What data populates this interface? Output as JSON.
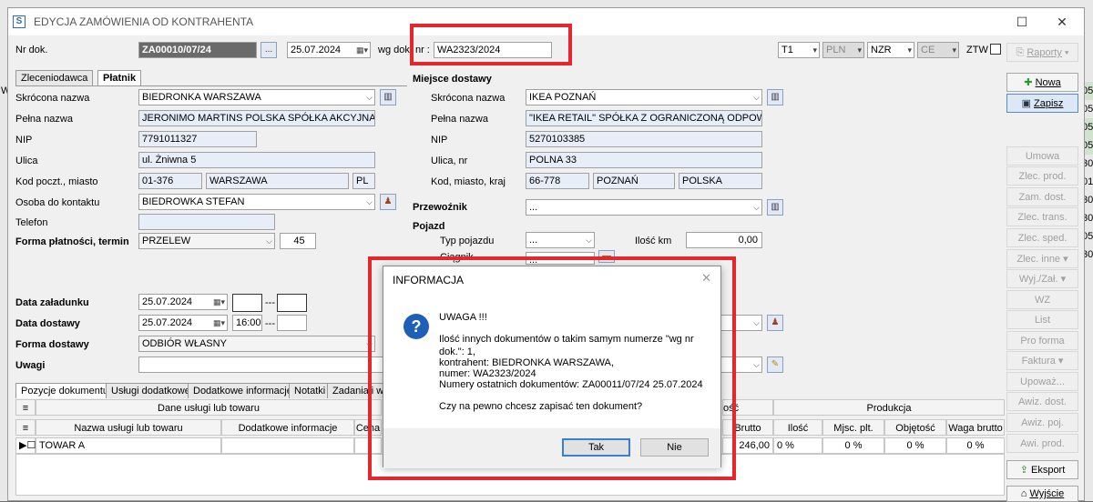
{
  "window": {
    "title": "EDYCJA ZAMÓWIENIA OD KONTRAHENTA",
    "minimize": "☐",
    "close": "✕"
  },
  "header": {
    "nr_dok_label": "Nr dok.",
    "nr_dok_value": "ZA00010/07/24",
    "ellipsis": "...",
    "date_value": "25.07.2024",
    "wg_dok_label": "wg dok. nr :",
    "wg_dok_value": "WA2323/2024",
    "t1": "T1",
    "currency": "PLN",
    "nzr": "NZR",
    "ce": "CE",
    "ztw_label": "ZTW",
    "raporty": "Raporty"
  },
  "client_tabs": [
    "Zleceniodawca",
    "Płatnik"
  ],
  "client": {
    "skrocona_label": "Skrócona nazwa",
    "skrocona_value": "BIEDRONKA WARSZAWA",
    "pelna_label": "Pełna nazwa",
    "pelna_value": "JERONIMO MARTINS POLSKA SPÓŁKA AKCYJNA",
    "nip_label": "NIP",
    "nip_value": "7791011327",
    "ulica_label": "Ulica",
    "ulica_value": "ul. Żniwna 5",
    "kod_label": "Kod poczt., miasto",
    "kod_value": "01-376",
    "miasto_value": "WARSZAWA",
    "kraj_value": "PL",
    "osoba_label": "Osoba do kontaktu",
    "osoba_value": "BIEDROWKA STEFAN",
    "telefon_label": "Telefon",
    "forma_platnosci_label": "Forma płatności, termin",
    "forma_platnosci_value": "PRZELEW",
    "termin_value": "45"
  },
  "delivery": {
    "section_label": "Miejsce dostawy",
    "skrocona_label": "Skrócona nazwa",
    "skrocona_value": "IKEA POZNAŃ",
    "pelna_label": "Pełna nazwa",
    "pelna_value": "\"IKEA RETAIL\" SPÓŁKA Z OGRANICZONĄ ODPOWIEDZI.",
    "nip_label": "NIP",
    "nip_value": "5270103385",
    "ulica_label": "Ulica, nr",
    "ulica_value": "POLNA 33",
    "kod_label": "Kod, miasto, kraj",
    "kod_value": "66-778",
    "miasto_value": "POZNAŃ",
    "kraj_value": "POLSKA",
    "przewoznik_label": "Przewoźnik",
    "przewoznik_value": "...",
    "pojazd_label": "Pojazd",
    "typ_label": "Typ pojazdu",
    "typ_value": "...",
    "ilosc_km_label": "Ilość km",
    "ilosc_km_value": "0,00",
    "ciagnik_label": "Ciągnik",
    "ciagnik_value": "..."
  },
  "dates": {
    "zaladunek_label": "Data załadunku",
    "zaladunek_value": "25.07.2024",
    "dostawa_label": "Data dostawy",
    "dostawa_value": "25.07.2024",
    "dostawa_time": "16:00",
    "forma_dostawy_label": "Forma dostawy",
    "forma_dostawy_value": "ODBIÓR WŁASNY",
    "uwagi_label": "Uwagi",
    "sep": "---"
  },
  "doc_tabs": [
    "Pozycje dokumentu",
    "Usługi dodatkowe",
    "Dodatkowe informacje",
    "Notatki",
    "Zadania i wa"
  ],
  "grid": {
    "group1": "Dane usługi lub towaru",
    "group_produkcja": "Produkcja",
    "col_name": "Nazwa usługi lub towaru",
    "col_info": "Dodatkowe informacje",
    "col_cena": "Cena",
    "col_brutto": "Brutto",
    "col_ilosc": "Ilość",
    "col_miejsc": "Mjsc. plt.",
    "col_objetosc": "Objętość",
    "col_waga": "Waga brutto",
    "col_o": "ość",
    "row_name": "TOWAR A",
    "row_brutto": "246,00",
    "row_ilosc": "0 %",
    "row_miejsc": "0 %",
    "row_objetosc": "0 %",
    "row_waga": "0 %"
  },
  "side_buttons": {
    "nowa": "Nowa",
    "zapisz": "Zapisz",
    "umowa": "Umowa",
    "zlec_prod": "Zlec. prod.",
    "zam_dost": "Zam. dost.",
    "zlec_trans": "Zlec. trans.",
    "zlec_sped": "Zlec. sped.",
    "zlec_inne": "Zlec. inne",
    "wyj_zal": "Wyj./Zał.",
    "wz": "WZ",
    "list": "List",
    "pro_forma": "Pro forma",
    "faktura": "Faktura",
    "upowaz": "Upoważ...",
    "awiz_dost": "Awiz. dost.",
    "awiz_poj": "Awiz. poj.",
    "awi_prod": "Awi. prod.",
    "eksport": "Eksport",
    "wyjscie": "Wyjście"
  },
  "background_right": [
    "05",
    "05",
    "05",
    "05",
    "30",
    "01",
    "30",
    "30",
    "05",
    "30"
  ],
  "background_left": "W",
  "dialog": {
    "title": "INFORMACJA",
    "close": "✕",
    "heading": "UWAGA !!!",
    "line1": "Ilość innych dokumentów o takim samym numerze \"wg nr",
    "line2": "dok.\": 1,",
    "line3": "kontrahent: BIEDRONKA WARSZAWA,",
    "line4": "numer: WA2323/2024",
    "line5": "Numery ostatnich dokumentów: ZA00011/07/24 25.07.2024",
    "question": "Czy na pewno chcesz zapisać ten dokument?",
    "yes": "Tak",
    "no": "Nie"
  },
  "colors": {
    "highlight": "#e8242c",
    "accent": "#1e5fb8"
  }
}
